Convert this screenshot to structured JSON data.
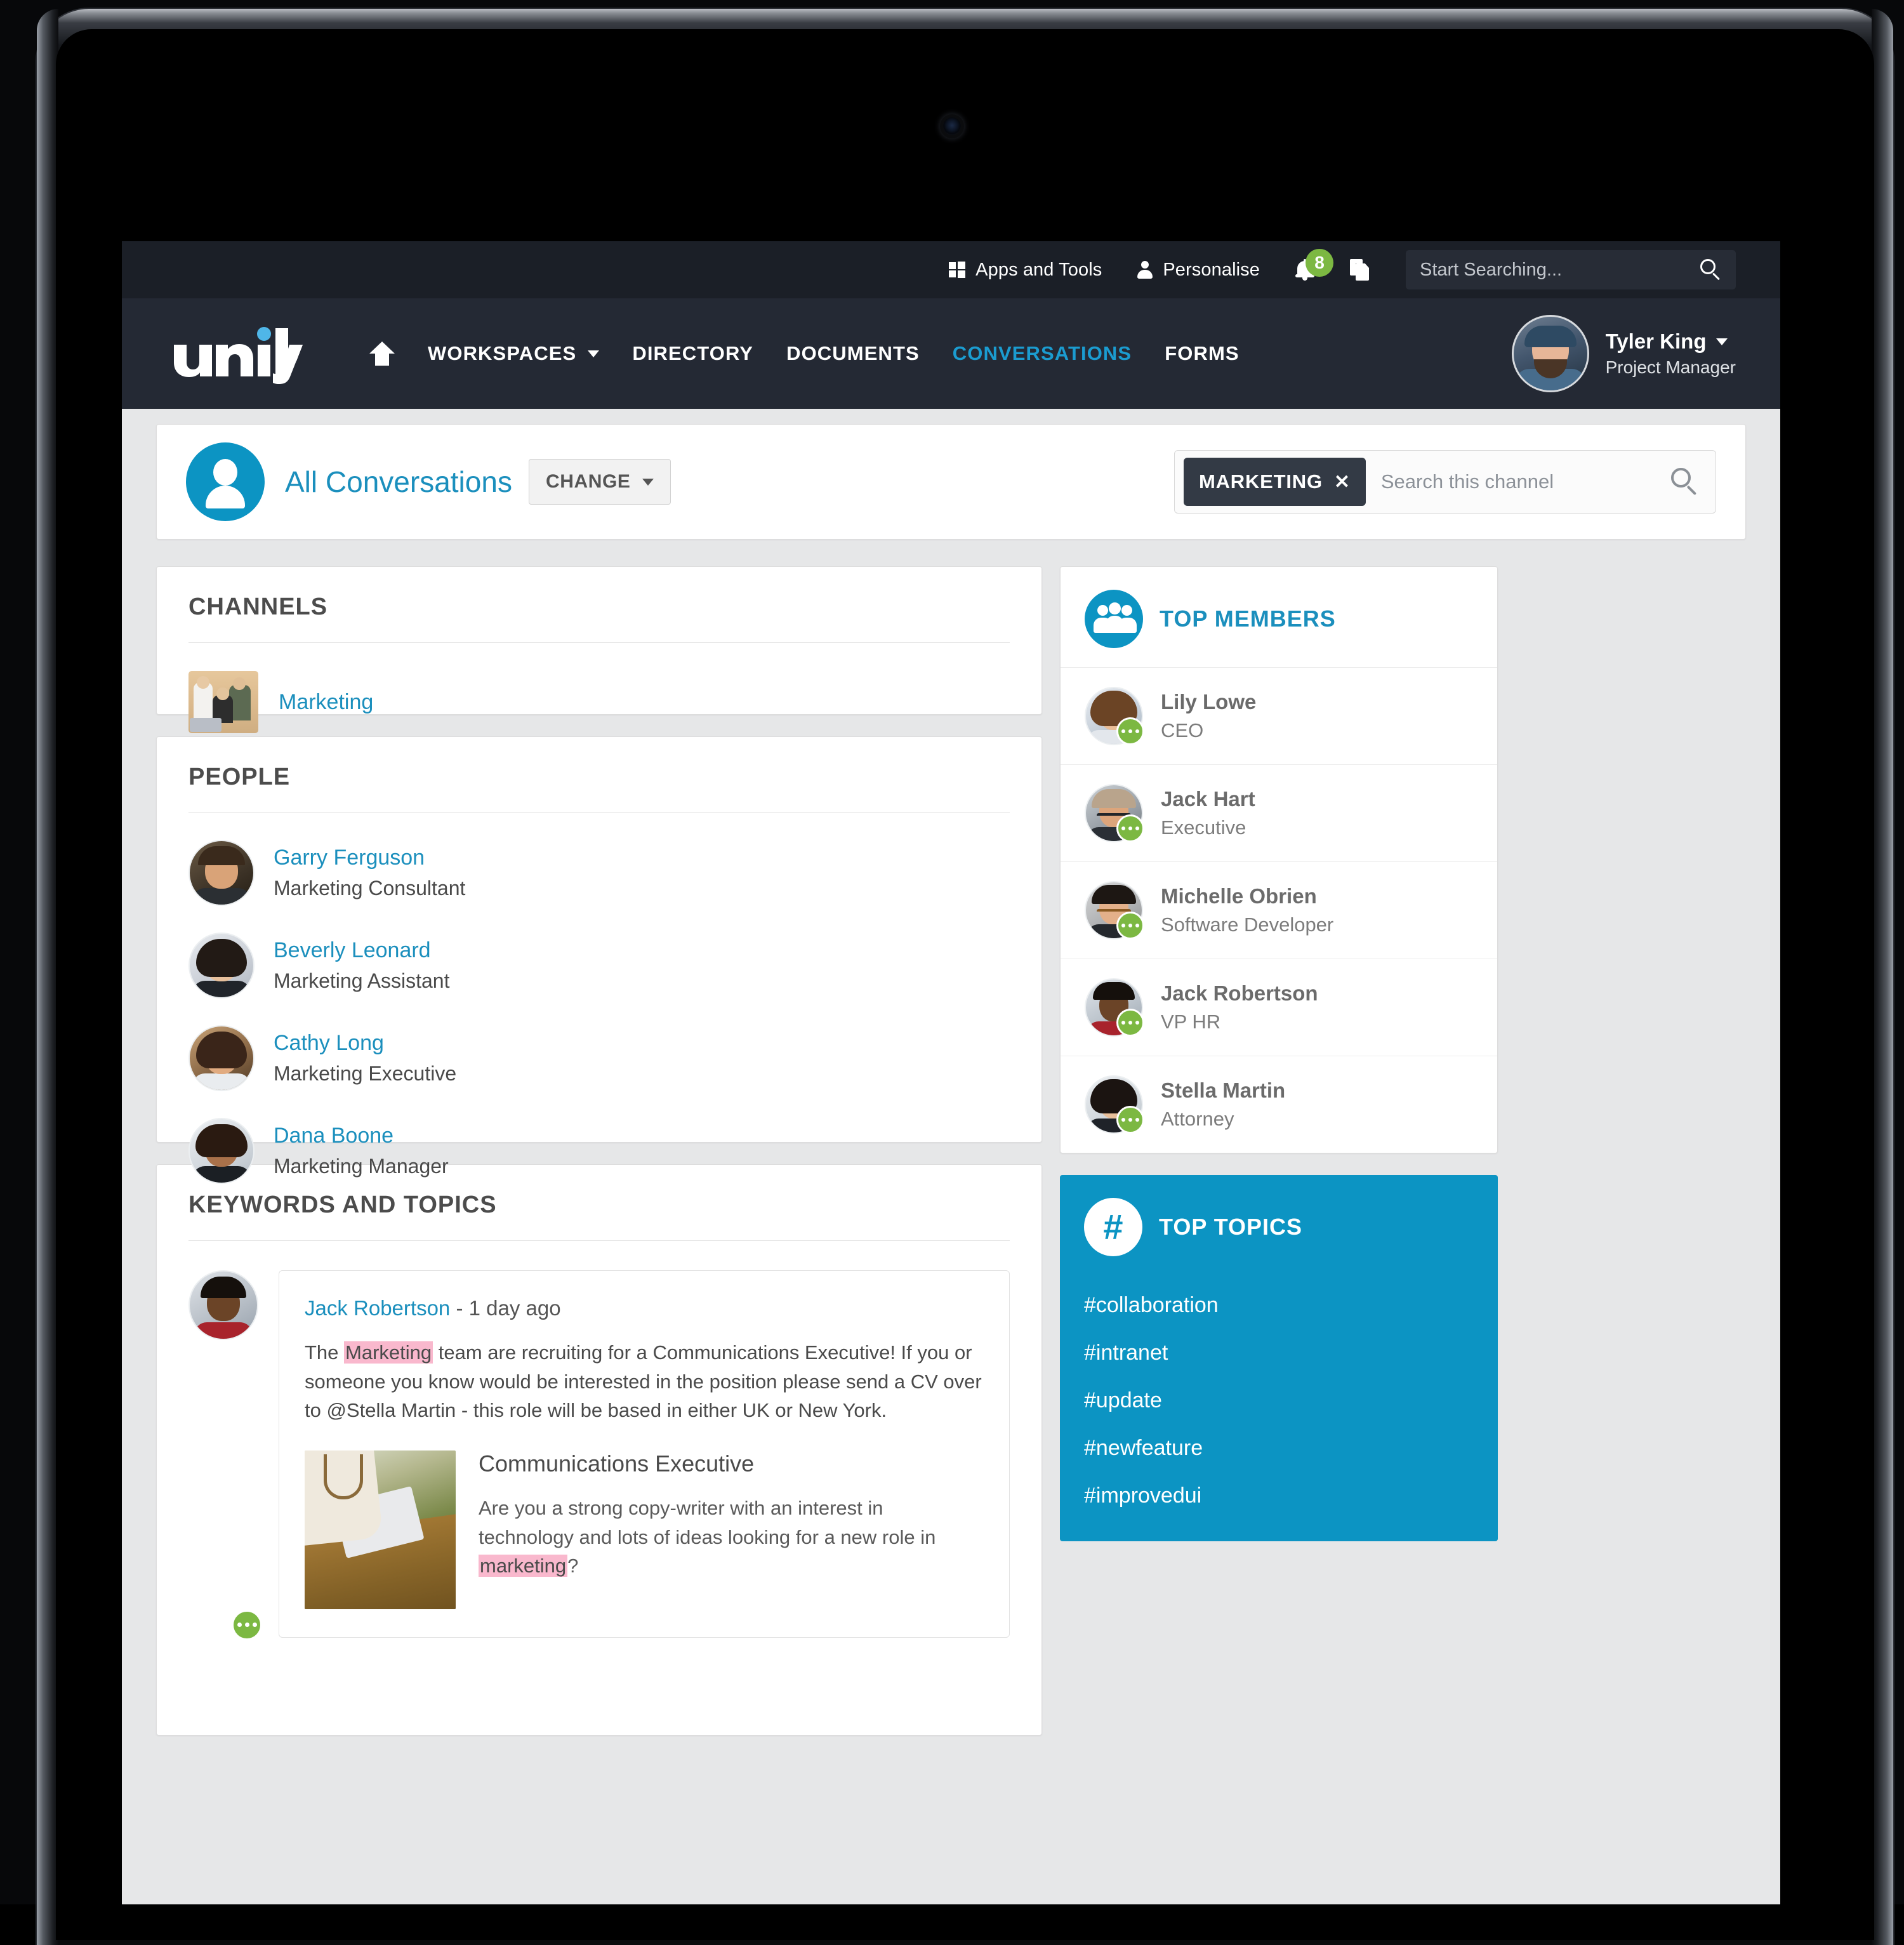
{
  "colors": {
    "brand_blue": "#0c94c3",
    "link_blue": "#1b8fbd",
    "nav_active": "#1b9cd0",
    "topbar_dark": "#1b1f27",
    "nav_dark": "#242934",
    "tag_dark": "#333a45",
    "badge_green": "#7cb842",
    "highlight_pink": "#f9b8cd",
    "page_bg": "#e6e7e8"
  },
  "utilbar": {
    "apps_and_tools": "Apps and Tools",
    "personalise": "Personalise",
    "notification_count": "8",
    "search_placeholder": "Start Searching..."
  },
  "mainnav": {
    "logo_text": "unily",
    "links": [
      {
        "label": "WORKSPACES",
        "active": false,
        "has_caret": true
      },
      {
        "label": "DIRECTORY",
        "active": false,
        "has_caret": false
      },
      {
        "label": "DOCUMENTS",
        "active": false,
        "has_caret": false
      },
      {
        "label": "CONVERSATIONS",
        "active": true,
        "has_caret": false
      },
      {
        "label": "FORMS",
        "active": false,
        "has_caret": false
      }
    ],
    "user": {
      "name": "Tyler King",
      "role": "Project Manager"
    }
  },
  "header": {
    "title": "All Conversations",
    "change_label": "CHANGE",
    "filter_tag": "MARKETING",
    "search_placeholder": "Search this channel"
  },
  "channels": {
    "title": "CHANNELS",
    "items": [
      {
        "name": "Marketing"
      }
    ]
  },
  "people": {
    "title": "PEOPLE",
    "items": [
      {
        "name": "Garry Ferguson",
        "role": "Marketing Consultant"
      },
      {
        "name": "Beverly Leonard",
        "role": "Marketing Assistant"
      },
      {
        "name": "Cathy Long",
        "role": "Marketing Executive"
      },
      {
        "name": "Dana Boone",
        "role": "Marketing Manager"
      }
    ]
  },
  "keywords": {
    "title": "KEYWORDS AND TOPICS",
    "post": {
      "author": "Jack Robertson",
      "timestamp": "- 1 day ago",
      "body_part1": "The ",
      "body_highlight1": "Marketing",
      "body_part2": " team are recruiting for a Communications Executive! If you or someone you know would be interested in the position please send a CV over to @Stella Martin - this role will be based in either UK or New York.",
      "attachment": {
        "title": "Communications Executive",
        "desc_part1": "Are you a strong copy-writer with an interest in technology and lots of ideas looking for a new role in ",
        "desc_highlight": "marketing",
        "desc_part2": "?"
      }
    }
  },
  "top_members": {
    "title": "TOP MEMBERS",
    "items": [
      {
        "name": "Lily Lowe",
        "role": "CEO"
      },
      {
        "name": "Jack Hart",
        "role": "Executive"
      },
      {
        "name": "Michelle Obrien",
        "role": "Software Developer"
      },
      {
        "name": "Jack Robertson",
        "role": "VP HR"
      },
      {
        "name": "Stella Martin",
        "role": "Attorney"
      }
    ]
  },
  "top_topics": {
    "title": "TOP TOPICS",
    "items": [
      "#collaboration",
      "#intranet",
      "#update",
      "#newfeature",
      "#improvedui"
    ]
  }
}
